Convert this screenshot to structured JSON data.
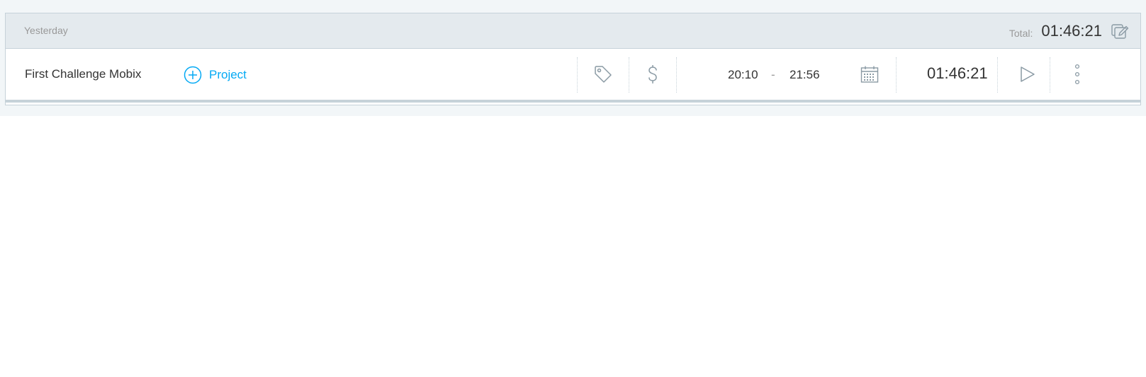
{
  "group": {
    "day_label": "Yesterday",
    "total_label": "Total:",
    "total_value": "01:46:21",
    "bulk_edit_icon": "bulk-edit-icon"
  },
  "entry": {
    "description": "First Challenge Mobix",
    "project_label": "Project",
    "start_time": "20:10",
    "dash": "-",
    "end_time": "21:56",
    "duration": "01:46:21",
    "icons": [
      "add-project-icon",
      "tag-icon",
      "dollar-icon",
      "calendar-icon",
      "play-icon",
      "more-vertical-icon"
    ]
  },
  "colors": {
    "accent": "#03a9f4",
    "header_bg": "#e4eaee",
    "page_bg": "#f2f6f8",
    "text": "#333333",
    "muted": "#999999",
    "icon": "#8a9aa4",
    "border": "#c6d2d9"
  }
}
